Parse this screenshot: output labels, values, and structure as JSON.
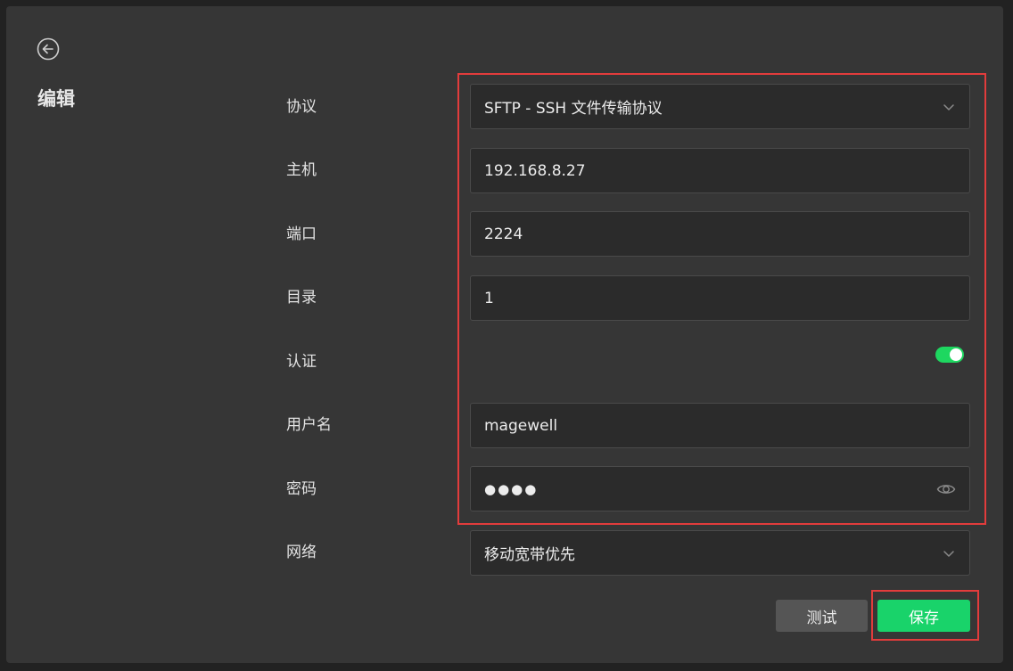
{
  "header": {
    "title": "编辑",
    "back_icon": "arrow-left-circle-icon"
  },
  "form": {
    "protocol": {
      "label": "协议",
      "value": "SFTP - SSH 文件传输协议"
    },
    "host": {
      "label": "主机",
      "value": "192.168.8.27"
    },
    "port": {
      "label": "端口",
      "value": "2224"
    },
    "directory": {
      "label": "目录",
      "value": "1"
    },
    "auth": {
      "label": "认证",
      "enabled": true
    },
    "username": {
      "label": "用户名",
      "value": "magewell"
    },
    "password": {
      "label": "密码",
      "masked": "●●●●"
    },
    "network": {
      "label": "网络",
      "value": "移动宽带优先"
    }
  },
  "actions": {
    "test_label": "测试",
    "save_label": "保存"
  },
  "colors": {
    "accent": "#19d36a",
    "highlight": "#e23c3c",
    "panel": "#363636",
    "field_bg": "#2b2b2b"
  }
}
